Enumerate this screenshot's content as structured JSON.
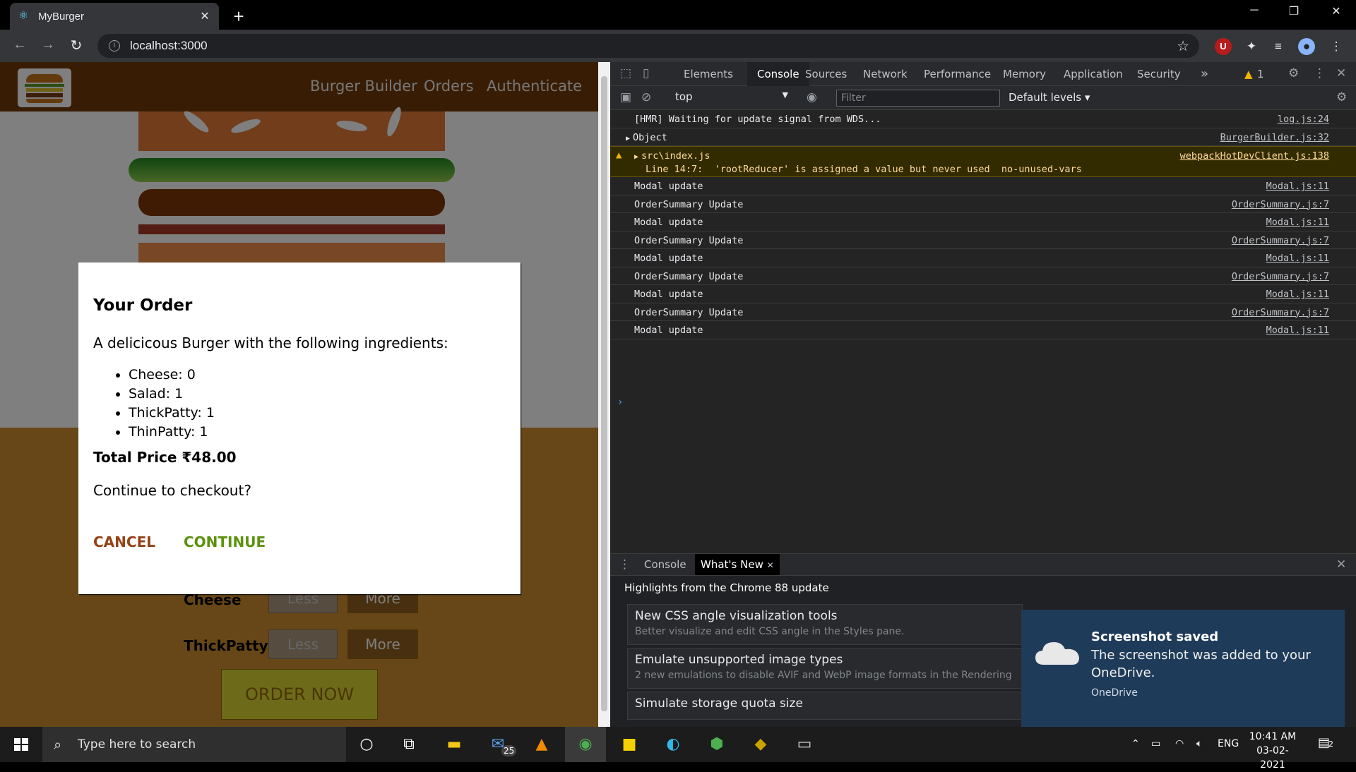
{
  "browser": {
    "tab_title": "MyBurger",
    "url": "localhost:3000"
  },
  "app": {
    "nav": [
      "Burger Builder",
      "Orders",
      "Authenticate"
    ],
    "controls": [
      {
        "label": "Cheese",
        "less": "Less",
        "more": "More"
      },
      {
        "label": "ThickPatty",
        "less": "Less",
        "more": "More"
      }
    ],
    "order_button": "ORDER NOW"
  },
  "modal": {
    "title": "Your Order",
    "intro": "A delicicous Burger with the following ingredients:",
    "ingredients": [
      "Cheese: 0",
      "Salad: 1",
      "ThickPatty: 1",
      "ThinPatty: 1"
    ],
    "total": "Total Price ₹48.00",
    "question": "Continue to checkout?",
    "cancel": "CANCEL",
    "continue": "CONTINUE"
  },
  "devtools": {
    "tabs": [
      "Elements",
      "Console",
      "Sources",
      "Network",
      "Performance",
      "Memory",
      "Application",
      "Security"
    ],
    "more_tabs": "»",
    "warning_count": "1",
    "context": "top",
    "filter_placeholder": "Filter",
    "levels": "Default levels",
    "logs": [
      {
        "msg": "[HMR] Waiting for update signal from WDS...",
        "src": "log.js:24"
      },
      {
        "msg": "Object",
        "src": "BurgerBuilder.js:32"
      },
      {
        "msg": "src\\index.js",
        "msg2": "Line 14:7:  'rootReducer' is assigned a value but never used  no-unused-vars",
        "src": "webpackHotDevClient.js:138"
      },
      {
        "msg": "Modal update",
        "src": "Modal.js:11"
      },
      {
        "msg": "OrderSummary Update",
        "src": "OrderSummary.js:7"
      },
      {
        "msg": "Modal update",
        "src": "Modal.js:11"
      },
      {
        "msg": "OrderSummary Update",
        "src": "OrderSummary.js:7"
      },
      {
        "msg": "Modal update",
        "src": "Modal.js:11"
      },
      {
        "msg": "OrderSummary Update",
        "src": "OrderSummary.js:7"
      },
      {
        "msg": "Modal update",
        "src": "Modal.js:11"
      },
      {
        "msg": "OrderSummary Update",
        "src": "OrderSummary.js:7"
      },
      {
        "msg": "Modal update",
        "src": "Modal.js:11"
      }
    ],
    "drawer_tabs": [
      "Console",
      "What's New"
    ],
    "whats_new_headline": "Highlights from the Chrome 88 update",
    "cards": [
      {
        "title": "New CSS angle visualization tools",
        "desc": "Better visualize and edit CSS angle in the Styles pane."
      },
      {
        "title": "Emulate unsupported image types",
        "desc": "2 new emulations to disable AVIF and WebP image formats in the Rendering"
      },
      {
        "title": "Simulate storage quota size",
        "desc": ""
      }
    ]
  },
  "toast": {
    "title": "Screenshot saved",
    "body": "The screenshot was added to your OneDrive.",
    "app": "OneDrive"
  },
  "taskbar": {
    "search_placeholder": "Type here to search",
    "mail_badge": "25",
    "language": "ENG",
    "time": "10:41 AM",
    "date": "03-02-2021",
    "notification_count": "2"
  }
}
